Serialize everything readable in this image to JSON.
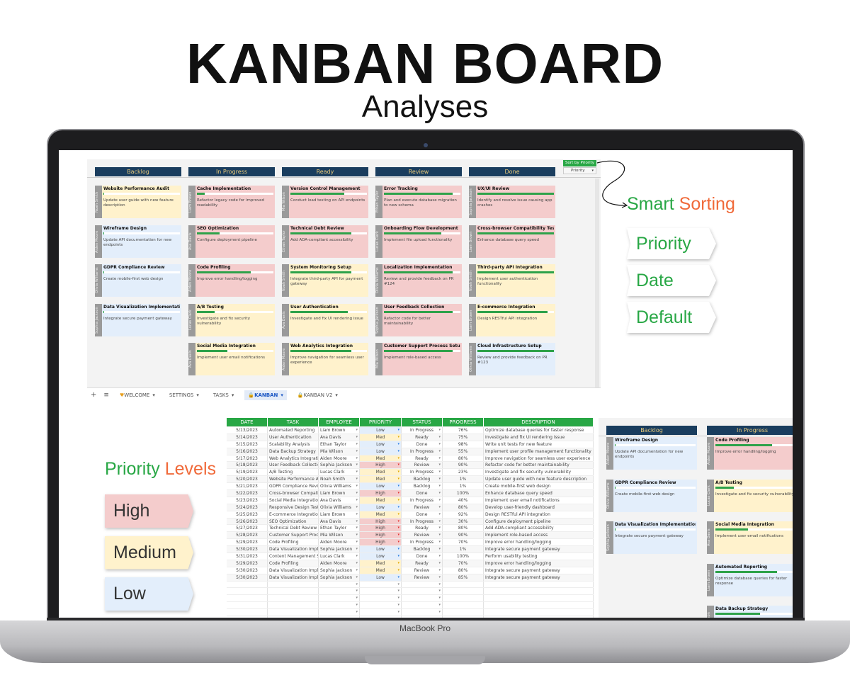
{
  "title": "KANBAN BOARD",
  "subtitle": "Analyses",
  "device_label": "MacBook Pro",
  "colors": {
    "high": "#f4cccc",
    "medium": "#fff2cc",
    "low": "#e3eefb",
    "header": "#1a3d5e",
    "accent": "#28a745",
    "orange": "#f06a3a"
  },
  "board": {
    "sort_button": "Sort by Priority",
    "sort_value": "Priority",
    "columns": [
      {
        "name": "Backlog",
        "cards": [
          {
            "title": "Website Performance Audit",
            "employee": "Noah Smith",
            "desc": "Update user guide with new feature description",
            "priority": "medium",
            "progress": 1
          },
          {
            "title": "Wireframe Design",
            "employee": "Aiden Moore",
            "desc": "Update API documentation for new endpoints",
            "priority": "low",
            "progress": 1
          },
          {
            "title": "GDPR Compliance Review",
            "employee": "Olivia Williams",
            "desc": "Create mobile-first web design",
            "priority": "low",
            "progress": 1
          },
          {
            "title": "Data Visualization Implementation",
            "employee": "Sophia Jackson",
            "desc": "Integrate secure payment gateway",
            "priority": "low",
            "progress": 1
          }
        ]
      },
      {
        "name": "In Progress",
        "cards": [
          {
            "title": "Cache Implementation",
            "employee": "Liam Brown",
            "desc": "Refactor legacy code for improved readability",
            "priority": "high",
            "progress": 10
          },
          {
            "title": "SEO Optimization",
            "employee": "Ava Davis",
            "desc": "Configure deployment pipeline",
            "priority": "high",
            "progress": 30
          },
          {
            "title": "Code Profiling",
            "employee": "Aiden Moore",
            "desc": "Improve error handling/logging",
            "priority": "high",
            "progress": 70
          },
          {
            "title": "A/B Testing",
            "employee": "Lucas Clark",
            "desc": "Investigate and fix security vulnerability",
            "priority": "medium",
            "progress": 23
          },
          {
            "title": "Social Media Integration",
            "employee": "Ava Davis",
            "desc": "Implement user email notifications",
            "priority": "medium",
            "progress": 40
          }
        ]
      },
      {
        "name": "Ready",
        "cards": [
          {
            "title": "Version Control Management",
            "employee": "Mia Wilson",
            "desc": "Conduct load testing on API endpoints",
            "priority": "high",
            "progress": 70
          },
          {
            "title": "Technical Debt Review",
            "employee": "Ethan Taylor",
            "desc": "Add ADA-compliant accessibility",
            "priority": "high",
            "progress": 80
          },
          {
            "title": "System Monitoring Setup",
            "employee": "Noah Smith",
            "desc": "Integrate third-party API for payment gateway",
            "priority": "medium",
            "progress": 80
          },
          {
            "title": "User Authentication",
            "employee": "Ava Davis",
            "desc": "Investigate and fix UI rendering issue",
            "priority": "medium",
            "progress": 75
          },
          {
            "title": "Web Analytics Integration",
            "employee": "Aiden Moore",
            "desc": "Improve navigation for seamless user experience",
            "priority": "medium",
            "progress": 80
          }
        ]
      },
      {
        "name": "Review",
        "cards": [
          {
            "title": "Error Tracking",
            "employee": "Ethan Taylor",
            "desc": "Plan and execute database migration to new schema",
            "priority": "high",
            "progress": 90
          },
          {
            "title": "Onboarding Flow Development",
            "employee": "Lucas Clark",
            "desc": "Implement file upload functionality",
            "priority": "high",
            "progress": 75
          },
          {
            "title": "Localization Implementation",
            "employee": "Olivia Williams",
            "desc": "Review and provide feedback on PR #124",
            "priority": "high",
            "progress": 90
          },
          {
            "title": "User Feedback Collection",
            "employee": "Sophia Jackson",
            "desc": "Refactor code for better maintainability",
            "priority": "high",
            "progress": 90
          },
          {
            "title": "Customer Support Process Setup",
            "employee": "Mia Wilson",
            "desc": "Implement role-based access",
            "priority": "high",
            "progress": 90
          }
        ]
      },
      {
        "name": "Done",
        "cards": [
          {
            "title": "UX/UI Review",
            "employee": "Sophia Jackson",
            "desc": "Identify and resolve issue causing app crashes",
            "priority": "high",
            "progress": 100
          },
          {
            "title": "Cross-browser Compatibility Testing",
            "employee": "Liam Brown",
            "desc": "Enhance database query speed",
            "priority": "high",
            "progress": 100
          },
          {
            "title": "Third-party API Integration",
            "employee": "Noah Smith",
            "desc": "Implement user authentication functionality",
            "priority": "medium",
            "progress": 100
          },
          {
            "title": "E-commerce Integration",
            "employee": "Liam Brown",
            "desc": "Design RESTful API integration",
            "priority": "medium",
            "progress": 92
          },
          {
            "title": "Cloud Infrastructure Setup",
            "employee": "Olivia Williams",
            "desc": "Review and provide feedback on PR #123",
            "priority": "low",
            "progress": 100
          }
        ]
      }
    ]
  },
  "sheet_tabs": [
    {
      "icon": "heart-icon",
      "label": "WELCOME"
    },
    {
      "icon": "",
      "label": "SETTINGS"
    },
    {
      "icon": "",
      "label": "TASKS"
    },
    {
      "icon": "lock-icon",
      "label": "KANBAN",
      "active": true
    },
    {
      "icon": "lock-icon",
      "label": "KANBAN V2"
    }
  ],
  "annotations": {
    "smart": "Smart",
    "sorting": "Sorting",
    "sort_options": [
      "Priority",
      "Date",
      "Default"
    ],
    "priority_word": "Priority",
    "levels_word": "Levels",
    "levels": [
      {
        "label": "High",
        "key": "high"
      },
      {
        "label": "Medium",
        "key": "medium"
      },
      {
        "label": "Low",
        "key": "low"
      }
    ]
  },
  "table": {
    "headers": [
      "DATE",
      "TASK",
      "EMPLOYEE",
      "PRIORITY",
      "STATUS",
      "PROGRESS",
      "DESCRIPTION"
    ],
    "rows": [
      [
        "5/13/2023",
        "Automated Reporting",
        "Liam Brown",
        "Low",
        "In Progress",
        "76%",
        "Optimize database queries for faster response"
      ],
      [
        "5/14/2023",
        "User Authentication",
        "Ava Davis",
        "Med",
        "Ready",
        "75%",
        "Investigate and fix UI rendering issue"
      ],
      [
        "5/15/2023",
        "Scalability Analysis",
        "Ethan Taylor",
        "Low",
        "Done",
        "98%",
        "Write unit tests for new feature"
      ],
      [
        "5/16/2023",
        "Data Backup Strategy",
        "Mia Wilson",
        "Low",
        "In Progress",
        "55%",
        "Implement user profile management functionality"
      ],
      [
        "5/17/2023",
        "Web Analytics Integration",
        "Aiden Moore",
        "Med",
        "Ready",
        "80%",
        "Improve navigation for seamless user experience"
      ],
      [
        "5/18/2023",
        "User Feedback Collection",
        "Sophia Jackson",
        "High",
        "Review",
        "90%",
        "Refactor code for better maintainability"
      ],
      [
        "5/19/2023",
        "A/B Testing",
        "Lucas Clark",
        "Med",
        "In Progress",
        "23%",
        "Investigate and fix security vulnerability"
      ],
      [
        "5/20/2023",
        "Website Performance Audit",
        "Noah Smith",
        "Med",
        "Backlog",
        "1%",
        "Update user guide with new feature description"
      ],
      [
        "5/21/2023",
        "GDPR Compliance Review",
        "Olivia Williams",
        "Low",
        "Backlog",
        "1%",
        "Create mobile-first web design"
      ],
      [
        "5/22/2023",
        "Cross-browser Compatibility Testing",
        "Liam Brown",
        "High",
        "Done",
        "100%",
        "Enhance database query speed"
      ],
      [
        "5/23/2023",
        "Social Media Integration",
        "Ava Davis",
        "Med",
        "In Progress",
        "40%",
        "Implement user email notifications"
      ],
      [
        "5/24/2023",
        "Responsive Design Testing",
        "Olivia Williams",
        "Low",
        "Review",
        "80%",
        "Develop user-friendly dashboard"
      ],
      [
        "5/25/2023",
        "E-commerce Integration",
        "Liam Brown",
        "Med",
        "Done",
        "92%",
        "Design RESTful API integration"
      ],
      [
        "5/26/2023",
        "SEO Optimization",
        "Ava Davis",
        "High",
        "In Progress",
        "30%",
        "Configure deployment pipeline"
      ],
      [
        "5/27/2023",
        "Technical Debt Review",
        "Ethan Taylor",
        "High",
        "Ready",
        "80%",
        "Add ADA-compliant accessibility"
      ],
      [
        "5/28/2023",
        "Customer Support Process Setup",
        "Mia Wilson",
        "High",
        "Review",
        "90%",
        "Implement role-based access"
      ],
      [
        "5/29/2023",
        "Code Profiling",
        "Aiden Moore",
        "High",
        "In Progress",
        "70%",
        "Improve error handling/logging"
      ],
      [
        "5/30/2023",
        "Data Visualization Implementation",
        "Sophia Jackson",
        "Low",
        "Backlog",
        "1%",
        "Integrate secure payment gateway"
      ],
      [
        "5/31/2023",
        "Content Management System",
        "Lucas Clark",
        "Low",
        "Done",
        "100%",
        "Perform usability testing"
      ],
      [
        "5/29/2023",
        "Code Profiling",
        "Aiden Moore",
        "Med",
        "Ready",
        "70%",
        "Improve error handling/logging"
      ],
      [
        "5/30/2023",
        "Data Visualization Implementation",
        "Sophia Jackson",
        "Med",
        "Review",
        "80%",
        "Integrate secure payment gateway"
      ],
      [
        "5/30/2023",
        "Data Visualization Implementation",
        "Sophia Jackson",
        "Low",
        "Review",
        "85%",
        "Integrate secure payment gateway"
      ]
    ]
  },
  "mini_board": {
    "columns": [
      {
        "name": "Backlog",
        "cards": [
          {
            "title": "Wireframe Design",
            "employee": "Aiden Moore",
            "desc": "Update API documentation for new endpoints",
            "priority": "low",
            "progress": 1
          },
          {
            "title": "GDPR Compliance Review",
            "employee": "Olivia Williams",
            "desc": "Create mobile-first web design",
            "priority": "low",
            "progress": 1
          },
          {
            "title": "Data Visualization Implementation",
            "employee": "Sophia Jackson",
            "desc": "Integrate secure payment gateway",
            "priority": "low",
            "progress": 1
          }
        ]
      },
      {
        "name": "In Progress",
        "cards": [
          {
            "title": "Code Profiling",
            "employee": "Aiden Moore",
            "desc": "Improve error handling/logging",
            "priority": "high",
            "progress": 70
          },
          {
            "title": "A/B Testing",
            "employee": "Lucas Clark",
            "desc": "Investigate and fix security vulnerability",
            "priority": "medium",
            "progress": 23
          },
          {
            "title": "Social Media Integration",
            "employee": "Ava Davis",
            "desc": "Implement user email notifications",
            "priority": "medium",
            "progress": 40
          },
          {
            "title": "Automated Reporting",
            "employee": "Liam Brown",
            "desc": "Optimize database queries for faster response",
            "priority": "low",
            "progress": 76
          },
          {
            "title": "Data Backup Strategy",
            "employee": "Mia Wilson",
            "desc": "",
            "priority": "low",
            "progress": 55
          }
        ]
      }
    ]
  }
}
